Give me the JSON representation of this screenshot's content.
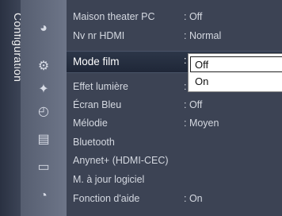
{
  "sidebar": {
    "label": "Configuration"
  },
  "menu": {
    "items": [
      {
        "label": "Maison theater PC",
        "value": ": Off"
      },
      {
        "label": "Nv nr HDMI",
        "value": ": Normal"
      },
      {
        "label": "Mode film",
        "value": ":"
      },
      {
        "label": "Effet lumière",
        "value": ":"
      },
      {
        "label": "Écran Bleu",
        "value": ": Off"
      },
      {
        "label": "Mélodie",
        "value": ": Moyen"
      },
      {
        "label": "Bluetooth",
        "value": ""
      },
      {
        "label": "Anynet+ (HDMI-CEC)",
        "value": ""
      },
      {
        "label": "M. à jour logiciel",
        "value": ""
      },
      {
        "label": "Fonction d'aide",
        "value": ": On"
      }
    ],
    "selected_index": 2
  },
  "dropdown": {
    "options": [
      "Off",
      "On"
    ],
    "highlighted": "Off"
  },
  "icons": [
    "satellite-dish-icon",
    "gear-icon",
    "star-icon",
    "clock-icon",
    "input-icon",
    "picture-icon",
    "sound-icon"
  ]
}
